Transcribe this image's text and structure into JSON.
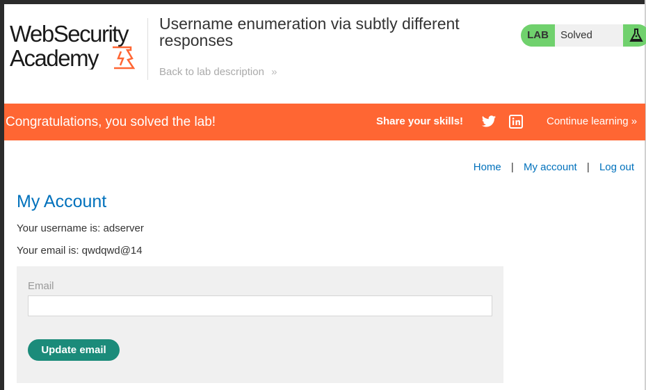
{
  "header": {
    "logo_text": "Web Security Academy",
    "lab_title": "Username enumeration via subtly different responses",
    "back_link": "Back to lab description",
    "lab_badge_label": "LAB",
    "lab_status": "Solved"
  },
  "banner": {
    "congrats": "Congratulations, you solved the lab!",
    "share": "Share your skills!",
    "continue": "Continue learning"
  },
  "nav": {
    "home": "Home",
    "my_account": "My account",
    "log_out": "Log out",
    "separator": "|"
  },
  "main": {
    "title": "My Account",
    "username_line": "Your username is: adserver",
    "email_line": "Your email is: qwdqwd@14",
    "email_label": "Email",
    "email_value": "",
    "update_button": "Update email"
  },
  "colors": {
    "accent_blue": "#0071bc",
    "banner_orange": "#ff6633",
    "solved_green": "#70d16d",
    "button_teal": "#1b8b7a"
  },
  "icons": {
    "back_chevron": "double-chevron-right-icon",
    "twitter": "twitter-icon",
    "linkedin": "linkedin-icon",
    "flask": "flask-icon"
  }
}
